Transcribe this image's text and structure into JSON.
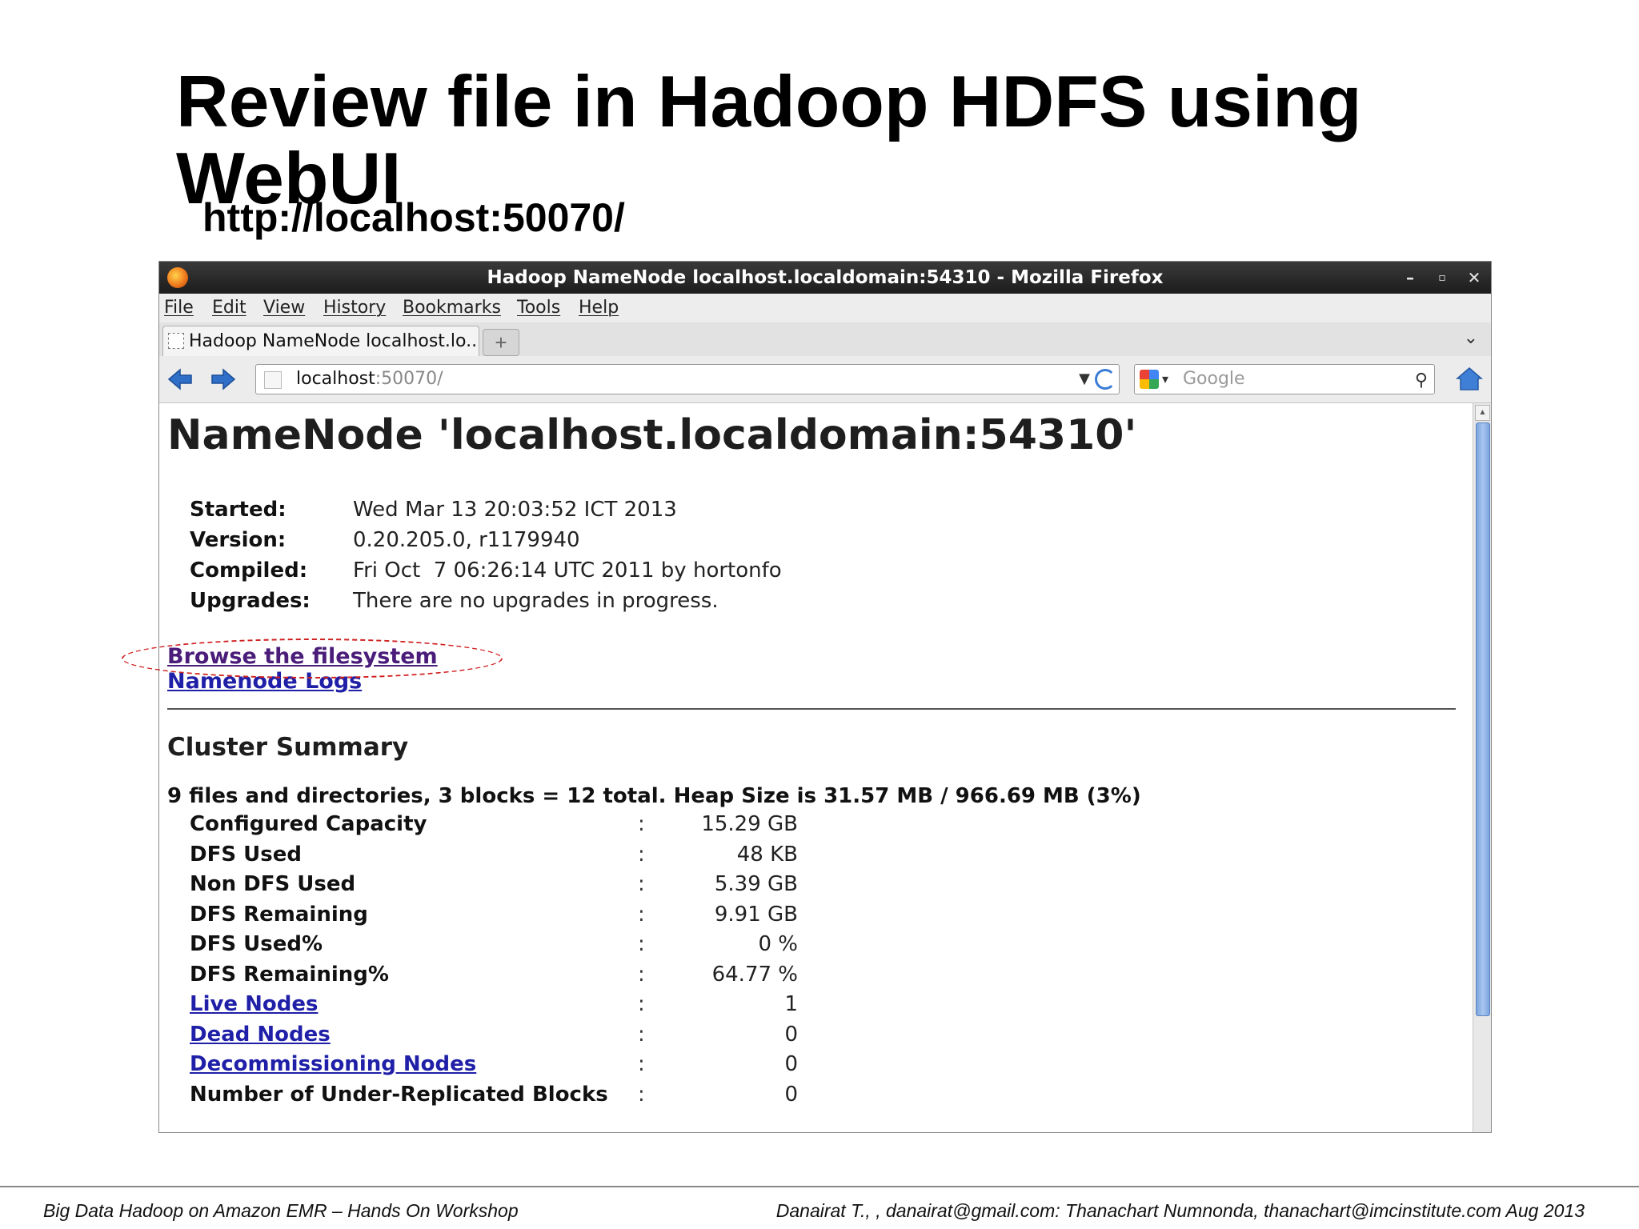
{
  "slide": {
    "title": "Review file in Hadoop HDFS using WebUI",
    "subtitle": "http://localhost:50070/",
    "footer_left": "Big Data Hadoop on Amazon EMR – Hands On Workshop",
    "footer_right": "Danairat T., , danairat@gmail.com:  Thanachart Numnonda,  thanachart@imcinstitute.com   Aug 2013"
  },
  "browser": {
    "window_title": "Hadoop NameNode localhost.localdomain:54310 - Mozilla Firefox",
    "menu": [
      "File",
      "Edit",
      "View",
      "History",
      "Bookmarks",
      "Tools",
      "Help"
    ],
    "tab_label": "Hadoop NameNode localhost.lo...",
    "url_host": "localhost",
    "url_rest": ":50070/",
    "search_placeholder": "Google"
  },
  "page": {
    "heading": "NameNode 'localhost.localdomain:54310'",
    "info": [
      {
        "key": "Started:",
        "value": "Wed Mar 13 20:03:52 ICT 2013"
      },
      {
        "key": "Version:",
        "value": "0.20.205.0, r1179940"
      },
      {
        "key": "Compiled:",
        "value": "Fri Oct  7 06:26:14 UTC 2011 by hortonfo"
      },
      {
        "key": "Upgrades:",
        "value": "There are no upgrades in progress."
      }
    ],
    "link_browse": "Browse the filesystem",
    "link_logs": "Namenode Logs",
    "cluster_title": "Cluster Summary",
    "cluster_summary": "9 files and directories, 3 blocks = 12 total. Heap Size is 31.57 MB / 966.69 MB (3%)",
    "stats_sep": ":",
    "stats": [
      {
        "label": "Configured Capacity",
        "value": "15.29 GB",
        "link": false
      },
      {
        "label": "DFS Used",
        "value": "48 KB",
        "link": false
      },
      {
        "label": "Non DFS Used",
        "value": "5.39 GB",
        "link": false
      },
      {
        "label": "DFS Remaining",
        "value": "9.91 GB",
        "link": false
      },
      {
        "label": "DFS Used%",
        "value": "0 %",
        "link": false
      },
      {
        "label": "DFS Remaining%",
        "value": "64.77 %",
        "link": false
      },
      {
        "label": "Live Nodes",
        "value": "1",
        "link": true
      },
      {
        "label": "Dead Nodes",
        "value": "0",
        "link": true
      },
      {
        "label": "Decommissioning Nodes",
        "value": "0",
        "link": true
      },
      {
        "label": "Number of Under-Replicated Blocks",
        "value": "0",
        "link": false
      }
    ]
  },
  "colors": {
    "link": "#1f1fa8",
    "visited_link": "#4b1d7a",
    "highlight": "#d02020",
    "titlebar": "#1c1c1c"
  },
  "icons": [
    "firefox-icon",
    "back-arrow-icon",
    "forward-arrow-icon",
    "reload-icon",
    "google-icon",
    "binoculars-icon",
    "home-icon"
  ]
}
